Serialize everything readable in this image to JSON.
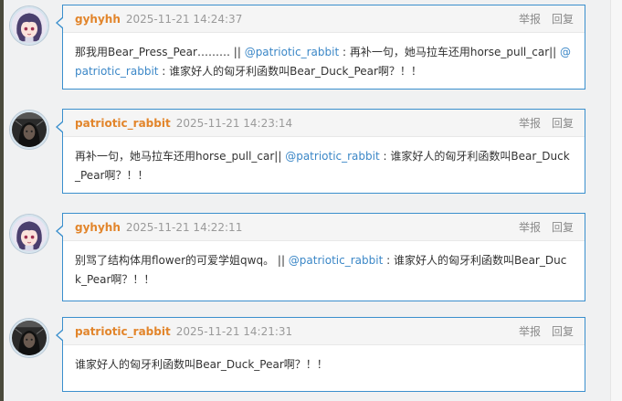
{
  "comments": [
    {
      "user": "gyhyhh",
      "time": "2025-11-21 14:24:37",
      "report": "举报",
      "reply": "回复",
      "avatar_icon": "anime-girl-avatar",
      "content": [
        {
          "text": "那我用Bear_Press_Pear……… || "
        },
        {
          "text": "@patriotic_rabbit",
          "mention": true
        },
        {
          "text": " : 再补一句，她马拉车还用horse_pull_car|| "
        },
        {
          "text": "@patriotic_rabbit",
          "mention": true
        },
        {
          "text": " : 谁家好人的匈牙利函数叫Bear_Duck_Pear啊？！！"
        }
      ]
    },
    {
      "user": "patriotic_rabbit",
      "time": "2025-11-21 14:23:14",
      "report": "举报",
      "reply": "回复",
      "avatar_icon": "dark-portrait-avatar",
      "content": [
        {
          "text": "再补一句，她马拉车还用horse_pull_car|| "
        },
        {
          "text": "@patriotic_rabbit",
          "mention": true
        },
        {
          "text": " : 谁家好人的匈牙利函数叫Bear_Duck_Pear啊？！！"
        }
      ]
    },
    {
      "user": "gyhyhh",
      "time": "2025-11-21 14:22:11",
      "report": "举报",
      "reply": "回复",
      "avatar_icon": "anime-girl-avatar",
      "content": [
        {
          "text": "别骂了结构体用flower的可爱学姐qwq。 || "
        },
        {
          "text": "@patriotic_rabbit",
          "mention": true
        },
        {
          "text": " : 谁家好人的匈牙利函数叫Bear_Duck_Pear啊？！！"
        }
      ]
    },
    {
      "user": "patriotic_rabbit",
      "time": "2025-11-21 14:21:31",
      "report": "举报",
      "reply": "回复",
      "avatar_icon": "dark-portrait-avatar",
      "content": [
        {
          "text": "谁家好人的匈牙利函数叫Bear_Duck_Pear啊？！！"
        }
      ]
    }
  ],
  "colors": {
    "border": "#3a8fcd",
    "username": "#e2852b",
    "mention": "#3b87c7",
    "header_bg": "#f5f5f5"
  }
}
